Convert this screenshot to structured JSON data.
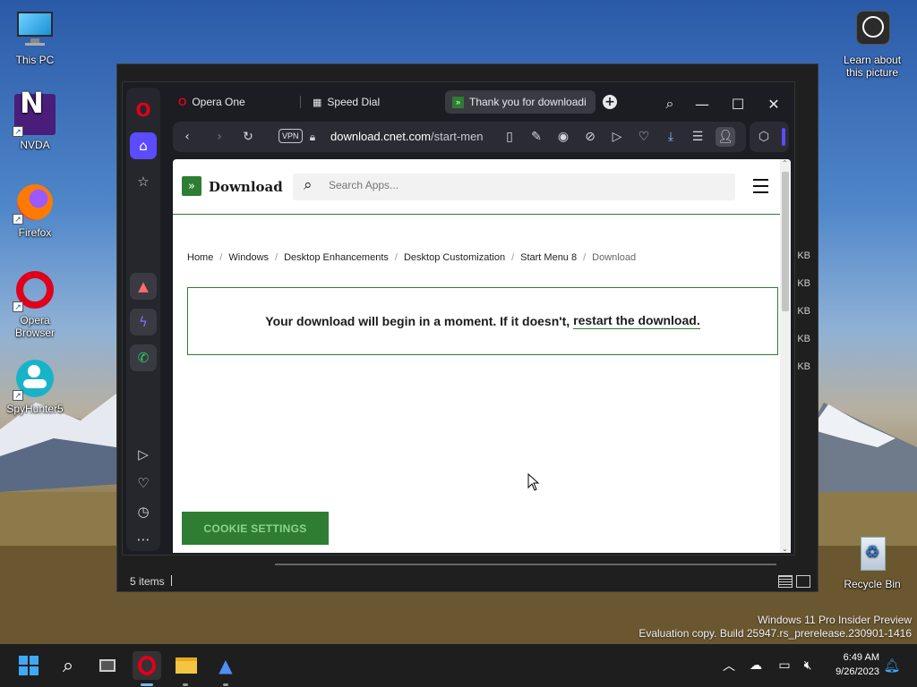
{
  "desktop": {
    "icons": [
      {
        "label": "This PC",
        "icon": "monitor-icon"
      },
      {
        "label": "NVDA",
        "icon": "nvda-icon"
      },
      {
        "label": "Firefox",
        "icon": "firefox-icon"
      },
      {
        "label": "Opera Browser",
        "icon": "opera-icon"
      },
      {
        "label": "SpyHunter5",
        "icon": "spyhunter-icon"
      }
    ],
    "learn_label": "Learn about this picture",
    "recycle_label": "Recycle Bin",
    "watermark_line1": "Windows 11 Pro Insider Preview",
    "watermark_line2": "Evaluation copy. Build 25947.rs_prerelease.230901-1416"
  },
  "explorer": {
    "status": "5 items",
    "kb_label": "KB"
  },
  "browser": {
    "tabs": [
      {
        "label": "Opera One",
        "active": false
      },
      {
        "label": "Speed Dial",
        "active": false
      },
      {
        "label": "Thank you for downloadi",
        "active": true
      }
    ],
    "vpn_label": "VPN",
    "url_domain": "download.cnet.com",
    "url_path": "/start-men"
  },
  "page": {
    "logo_text": "Download",
    "search_placeholder": "Search Apps...",
    "breadcrumb": [
      "Home",
      "Windows",
      "Desktop Enhancements",
      "Desktop Customization",
      "Start Menu 8",
      "Download"
    ],
    "notice_text": "Your download will begin in a moment. If it doesn't,",
    "notice_link": "restart the download.",
    "cookie_button": "COOKIE SETTINGS"
  },
  "taskbar": {
    "time": "6:49 AM",
    "date": "9/26/2023"
  },
  "colors": {
    "cnet_green": "#2e7d32",
    "opera_red": "#e0001b",
    "opera_accent": "#5b4cff"
  }
}
